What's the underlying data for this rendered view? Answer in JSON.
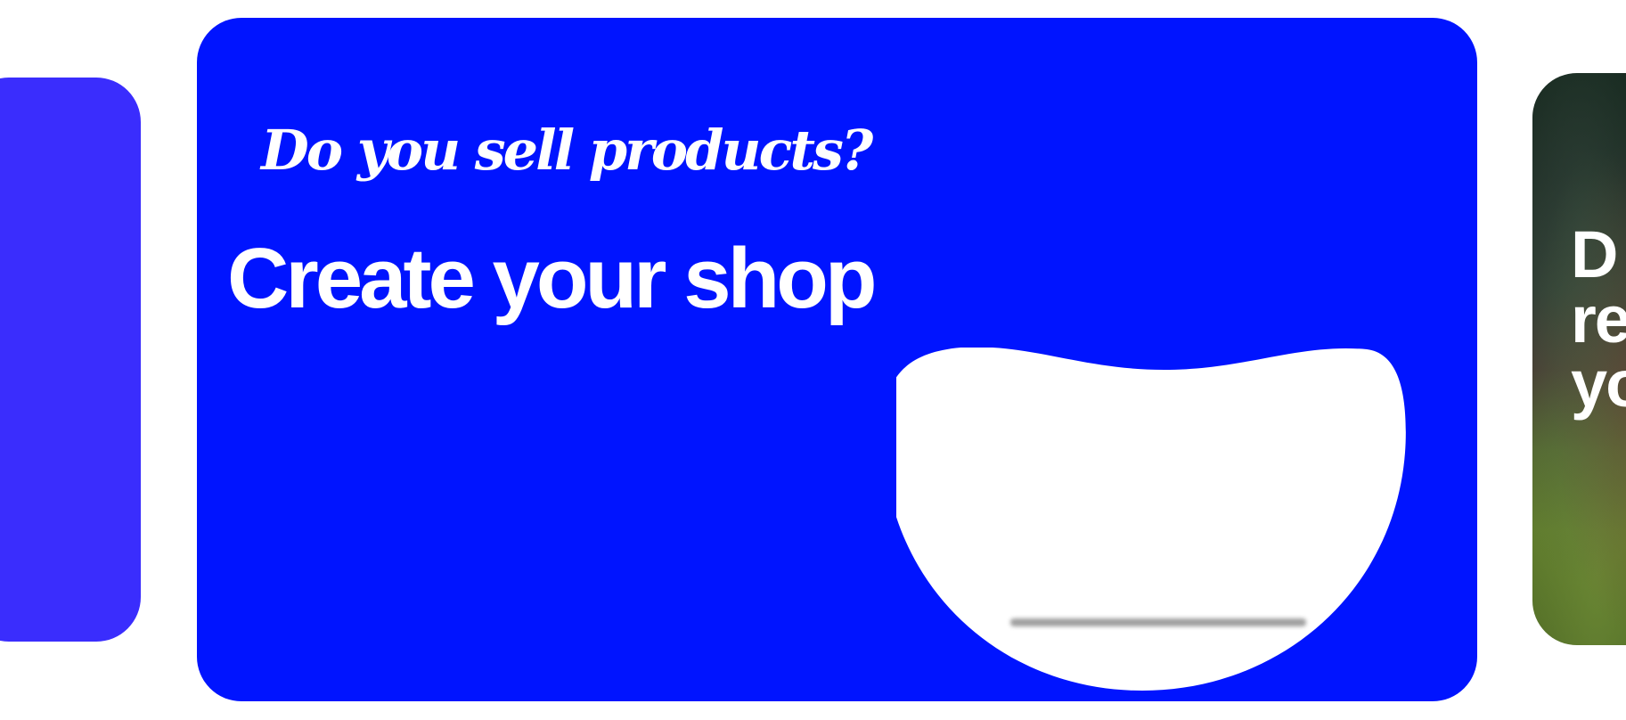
{
  "colors": {
    "page_background": "#ffffff",
    "left_card": "#3a2dfd",
    "main_card": "#0014ff",
    "text": "#ffffff",
    "blob": "#ffffff"
  },
  "main_card": {
    "script_line": "Do you sell products?",
    "headline": "Create your shop"
  },
  "right_card": {
    "peek_text": "D\nre\nyo"
  }
}
